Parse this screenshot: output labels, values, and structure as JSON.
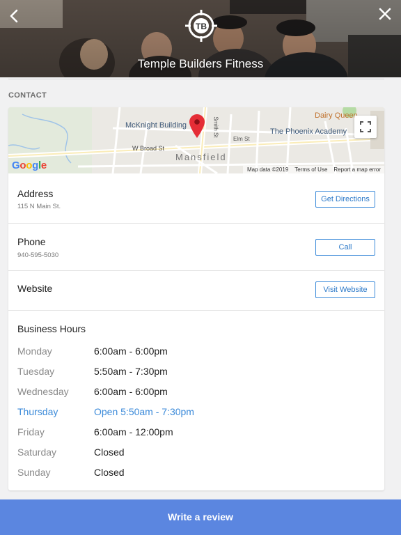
{
  "header": {
    "title": "Temple Builders Fitness",
    "back_icon": "chevron-left-icon",
    "close_icon": "close-icon"
  },
  "section_label": "CONTACT",
  "map": {
    "labels": {
      "mcknight": "McKnight Building",
      "phoenix": "The Phoenix Academy",
      "dairy": "Dairy Queen",
      "town": "Mansfield",
      "w_broad": "W Broad St",
      "elm": "Elm St",
      "smith": "Smith St",
      "main": "Main St"
    },
    "google_logo": "Google",
    "footer": [
      "Map data ©2019",
      "Terms of Use",
      "Report a map error"
    ]
  },
  "contact": {
    "address": {
      "title": "Address",
      "value": "115 N Main St.",
      "button": "Get Directions"
    },
    "phone": {
      "title": "Phone",
      "value": "940-595-5030",
      "button": "Call"
    },
    "website": {
      "title": "Website",
      "button": "Visit Website"
    }
  },
  "hours": {
    "title": "Business Hours",
    "days": [
      {
        "day": "Monday",
        "time": "6:00am - 6:00pm"
      },
      {
        "day": "Tuesday",
        "time": "5:50am - 7:30pm"
      },
      {
        "day": "Wednesday",
        "time": "6:00am - 6:00pm"
      },
      {
        "day": "Thursday",
        "time": "Open 5:50am - 7:30pm"
      },
      {
        "day": "Friday",
        "time": "6:00am - 12:00pm"
      },
      {
        "day": "Saturday",
        "time": "Closed"
      },
      {
        "day": "Sunday",
        "time": "Closed"
      }
    ]
  },
  "review_button": "Write a review",
  "colors": {
    "accent": "#3b8ad9",
    "review_bar": "#5b86e0",
    "pin": "#e52d36"
  }
}
